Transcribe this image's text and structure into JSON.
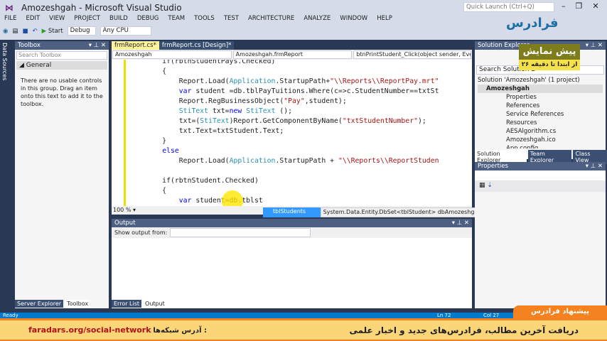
{
  "window": {
    "title": "Amozeshgah - Microsoft Visual Studio",
    "quick_launch": "Quick Launch (Ctrl+Q)"
  },
  "menu": [
    "FILE",
    "EDIT",
    "VIEW",
    "PROJECT",
    "BUILD",
    "DEBUG",
    "TEAM",
    "TOOLS",
    "TEST",
    "ARCHITECTURE",
    "ANALYZE",
    "WINDOW",
    "HELP"
  ],
  "toolbar": {
    "start": "Start",
    "config": "Debug",
    "platform": "Any CPU"
  },
  "side_tab": "Data Sources",
  "toolbox": {
    "title": "Toolbox",
    "search_placeholder": "Search Toolbox",
    "group": "General",
    "message": "There are no usable controls in this group. Drag an item onto this text to add it to the toolbox.",
    "tabs": [
      "Server Explorer",
      "Toolbox"
    ]
  },
  "editor": {
    "tabs": [
      "frmReport.cs*",
      "frmReport.cs [Design]*"
    ],
    "nav": [
      "Amozeshgah",
      "Amozeshgah.frmReport",
      "btnPrintStudent_Click(object sender, Eve"
    ],
    "zoom": "100 %"
  },
  "intellisense": {
    "item": "tblStudents",
    "tooltip": "System.Data.Entity.DbSet<tblStudent> dbAmozeshgahEntities.tblStudents"
  },
  "output": {
    "title": "Output",
    "show_from": "Show output from:",
    "tabs": [
      "Error List",
      "Output"
    ]
  },
  "solution_explorer": {
    "title": "Solution Explorer",
    "search": "Search Solution E",
    "items": [
      "Solution 'Amozeshgah' (1 project)",
      "Amozeshgah",
      "Properties",
      "References",
      "Service References",
      "Resources",
      "AESAlgorithm.cs",
      "Amozeshgah.ico",
      "App.config"
    ],
    "tabs": [
      "Solution Explorer",
      "Team Explorer",
      "Class View"
    ]
  },
  "properties": {
    "title": "Properties"
  },
  "status": {
    "ready": "Ready",
    "ln": "Ln 72",
    "col": "Col 27"
  },
  "overlay": {
    "logo": "فرادرس",
    "preview": "پیش نمایش",
    "preview_sub": "از ابتدا تا دقیقه ۲۶",
    "suggest": "پیشنهاد فرادرس",
    "link": "faradars.org/social-network",
    "link_label": "آدرس شبکه‌ها :",
    "headline": "دریافت آخرین مطالب، فرادرس‌های جدید و اخبار علمی"
  }
}
